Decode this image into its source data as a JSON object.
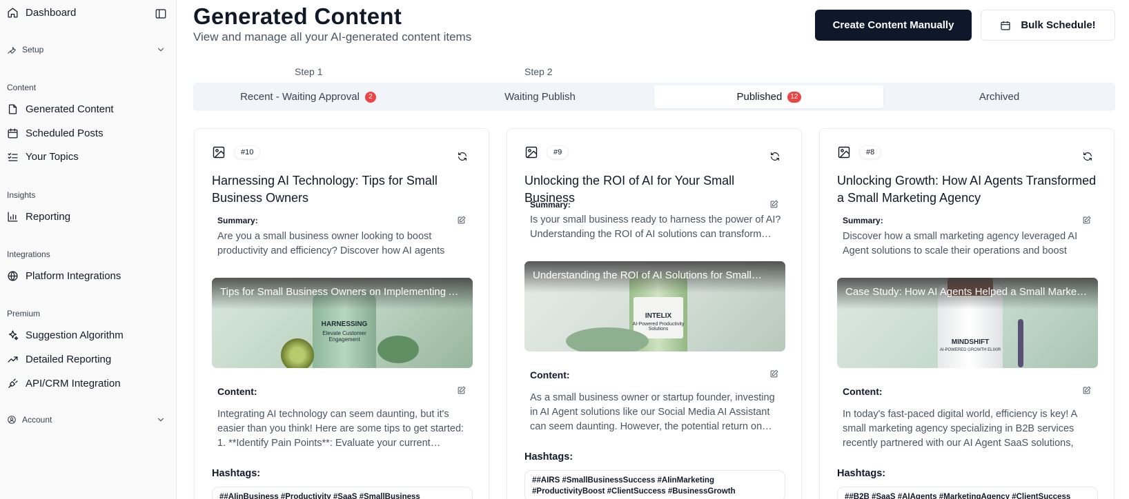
{
  "sidebar": {
    "dashboard": "Dashboard",
    "setup": "Setup",
    "sections": {
      "content": "Content",
      "insights": "Insights",
      "integrations": "Integrations",
      "premium": "Premium"
    },
    "content_items": [
      "Generated Content",
      "Scheduled Posts",
      "Your Topics"
    ],
    "insights_items": [
      "Reporting"
    ],
    "integrations_items": [
      "Platform Integrations"
    ],
    "premium_items": [
      "Suggestion Algorithm",
      "Detailed Reporting",
      "API/CRM Integration"
    ],
    "account": "Account"
  },
  "header": {
    "title": "Generated Content",
    "subtitle": "View and manage all your AI-generated content items",
    "create_button": "Create Content Manually",
    "bulk_button": "Bulk Schedule!"
  },
  "steps": [
    "Step 1",
    "Step 2"
  ],
  "tabs": [
    {
      "label": "Recent - Waiting Approval",
      "badge": "2"
    },
    {
      "label": "Waiting Publish",
      "badge": ""
    },
    {
      "label": "Published",
      "badge": "12"
    },
    {
      "label": "Archived",
      "badge": ""
    }
  ],
  "labels": {
    "summary": "Summary:",
    "content": "Content:",
    "hashtags": "Hashtags:"
  },
  "cards": [
    {
      "number": "#10",
      "title": "Harnessing AI Technology: Tips for Small Business Owners",
      "summary": "Are you a small business owner looking to boost productivity and efficiency? Discover how AI agents can…",
      "image_caption": "Tips for Small Business Owners on Implementing AI…",
      "image_label": "HARNESSING",
      "image_sublabel": "Elevate Customer Engagement",
      "content": "Integrating AI technology can seem daunting, but it's easier than you think! Here are some tips to get started: 1. **Identify Pain Points**: Evaluate your current…",
      "hashtags": "##AIinBusiness #Productivity #SaaS #SmallBusiness"
    },
    {
      "number": "#9",
      "title": "Unlocking the ROI of AI for Your Small Business",
      "summary": "Is your small business ready to harness the power of AI? Understanding the ROI of AI solutions can transform…",
      "image_caption": "Understanding the ROI of AI Solutions for Small…",
      "image_label": "INTELIX",
      "image_sublabel": "AI-Powered Productivity Solutions",
      "content": "As a small business owner or startup founder, investing in AI Agent solutions like our Social Media AI Assistant can seem daunting. However, the potential return on…",
      "hashtags": "##AIRS #SmallBusinessSuccess #AIinMarketing #ProductivityBoost #ClientSuccess #BusinessGrowth"
    },
    {
      "number": "#8",
      "title": "Unlocking Growth: How AI Agents Transformed a Small Marketing Agency",
      "summary": "Discover how a small marketing agency leveraged AI Agent solutions to scale their operations and boost clie…",
      "image_caption": "Case Study: How AI Agents Helped a Small Marketin…",
      "image_label": "MINDSHIFT",
      "image_sublabel": "AI-POWERED GROWTH ELIXIR",
      "content": "In today's fast-paced digital world, efficiency is key! A small marketing agency specializing in B2B services recently partnered with our AI Agent SaaS solutions, an…",
      "hashtags": "##B2B #SaaS #AIAgents #MarketingAgency #ClientSuccess"
    }
  ]
}
